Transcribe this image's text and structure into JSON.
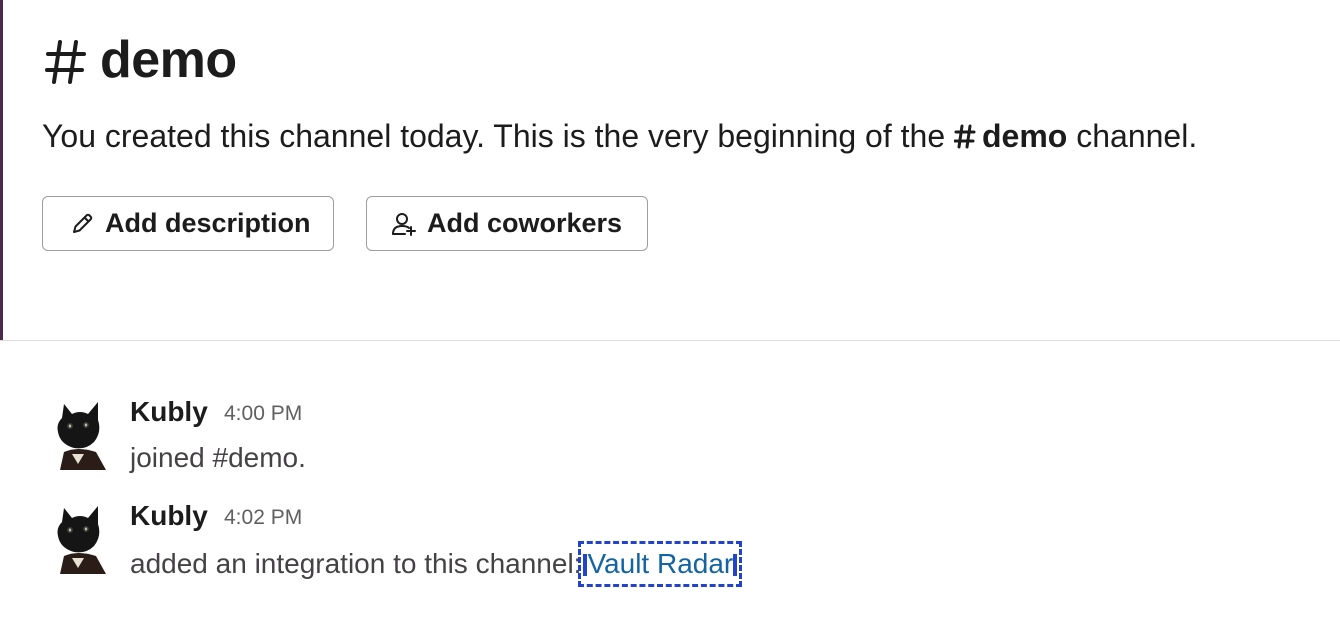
{
  "channel": {
    "name": "demo",
    "intro_prefix": "You created this channel today. This is the very beginning of the",
    "intro_channel": "demo",
    "intro_suffix": "channel."
  },
  "buttons": {
    "add_description": "Add description",
    "add_coworkers": "Add coworkers"
  },
  "messages": [
    {
      "author": "Kubly",
      "time": "4:00 PM",
      "text": "joined #demo."
    },
    {
      "author": "Kubly",
      "time": "4:02 PM",
      "text": "added an integration to this channel:",
      "link": "Vault Radar"
    }
  ],
  "colors": {
    "link": "#1264a3",
    "highlight": "#2244cc",
    "sidebar_edge": "#4a2a4d"
  },
  "icons": {
    "hash": "hash-icon",
    "pencil": "pencil-icon",
    "add_person": "add-person-icon",
    "avatar": "cat-avatar"
  }
}
